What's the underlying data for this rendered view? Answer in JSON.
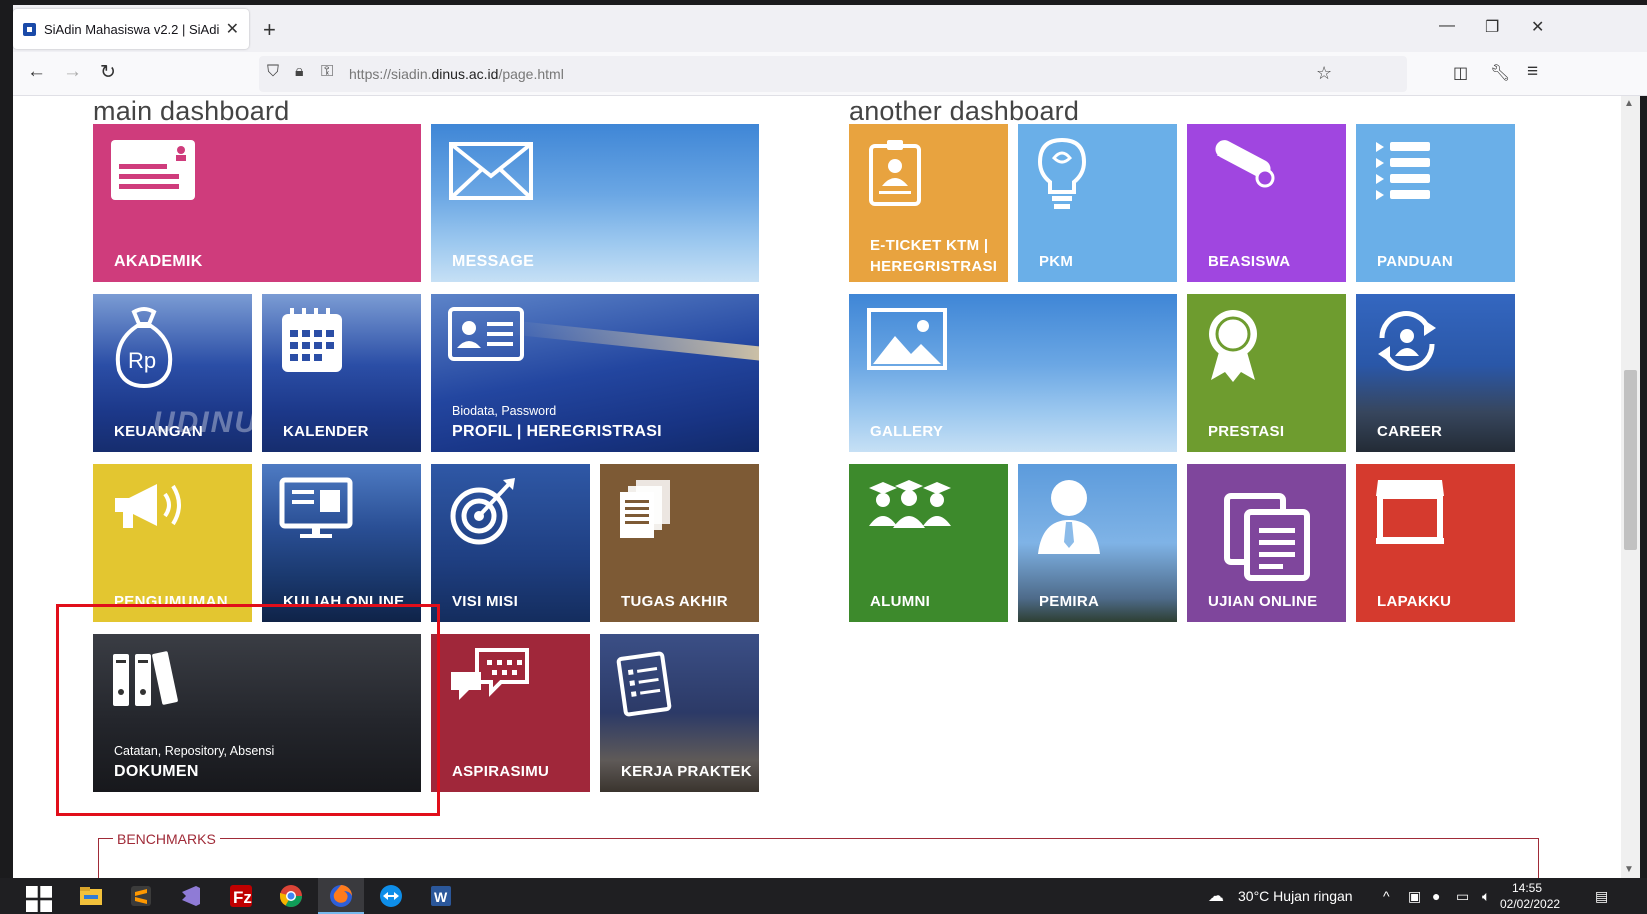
{
  "browser": {
    "tab_title": "SiAdin Mahasiswa v2.2 | SiAdin",
    "url_prefix": "https://siadin.",
    "url_domain": "dinus.ac.id",
    "url_path": "/page.html"
  },
  "main_dashboard": {
    "title": "main dashboard",
    "tiles": {
      "akademik": "AKADEMIK",
      "message": "MESSAGE",
      "keuangan": "KEUANGAN",
      "kalender": "KALENDER",
      "profil": "PROFIL | HEREGRISTRASI",
      "profil_sub": "Biodata, Password",
      "pengumuman": "PENGUMUMAN",
      "kuliah_online": "KULIAH ONLINE",
      "visi_misi": "VISI MISI",
      "tugas_akhir": "TUGAS AKHIR",
      "dokumen": "DOKUMEN",
      "dokumen_sub": "Catatan, Repository, Absensi",
      "aspirasimu": "ASPIRASIMU",
      "kerja_praktek": "KERJA PRAKTEK"
    },
    "building_text": "UDINUS"
  },
  "another_dashboard": {
    "title": "another dashboard",
    "tiles": {
      "eticket_1": "E-TICKET KTM |",
      "eticket_2": "HEREGRISTRASI",
      "pkm": "PKM",
      "beasiswa": "BEASISWA",
      "panduan": "PANDUAN",
      "gallery": "GALLERY",
      "prestasi": "PRESTASI",
      "career": "CAREER",
      "alumni": "ALUMNI",
      "pemira": "PEMIRA",
      "ujian_online": "UJIAN ONLINE",
      "lapakku": "LAPAKKU"
    }
  },
  "benchmarks": "BENCHMARKS",
  "taskbar": {
    "weather": "30°C  Hujan ringan",
    "time": "14:55",
    "date": "02/02/2022"
  },
  "colors": {
    "akademik": "#cf3c7c",
    "eticket": "#e8a33f",
    "beasiswa": "#a046e0",
    "prestasi": "#6e9c2f",
    "alumni": "#3d8a2c",
    "ujian_online": "#7f469c",
    "lapakku": "#d53a2e",
    "pengumuman": "#e3c630",
    "tugas_akhir": "#7d5a35",
    "aspirasimu": "#a0273a",
    "highlight": "#e10e1a"
  }
}
